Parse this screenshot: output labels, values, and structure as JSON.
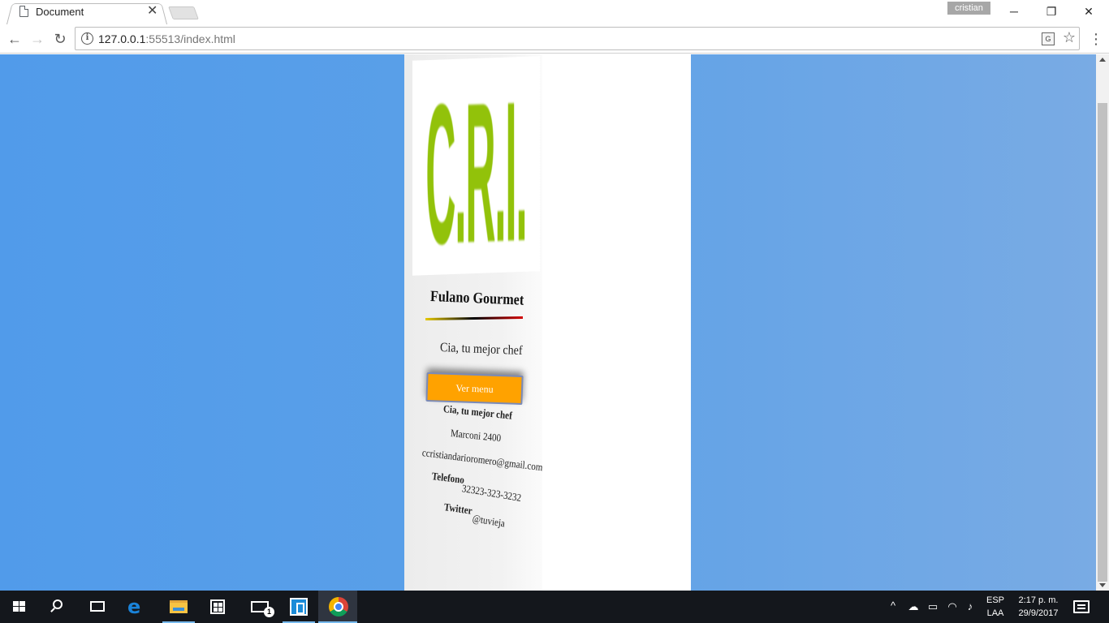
{
  "browser": {
    "tab_title": "Document",
    "tab_close": "✕",
    "profile_name": "cristian",
    "url_host": "127.0.0.1",
    "url_rest": ":55513/index.html",
    "window_buttons": {
      "minimize": "─",
      "restore": "❐",
      "close": "✕"
    },
    "nav": {
      "back": "←",
      "forward": "→",
      "reload": "↻"
    },
    "star": "☆",
    "menu": "⋮"
  },
  "page": {
    "logo_text": "C.R.I.",
    "brand_title": "Fulano Gourmet",
    "slogan": "Cia, tu mejor chef",
    "menu_button": "Ver menu",
    "footer": {
      "company": "Cia, tu mejor chef",
      "address": "Marconi 2400",
      "email": "ccristiandarioromero@gmail.com",
      "phone_label": "Telefono",
      "phone_value": "32323-323-3232",
      "twitter_label": "Twitter",
      "twitter_value": "@tuvieja"
    },
    "colors": {
      "background_blue": "#519bea",
      "logo_green": "#92c20a",
      "button_orange": "#ffa200"
    }
  },
  "taskbar": {
    "mail_badge": "1",
    "language": "ESP",
    "language_sub": "LAA",
    "time": "2:17 p. m.",
    "date": "29/9/2017",
    "tray_chevron": "^"
  }
}
